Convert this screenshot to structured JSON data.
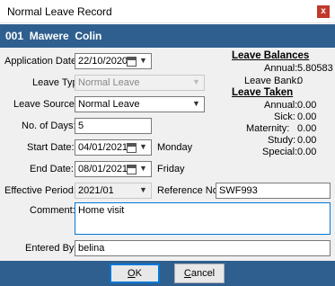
{
  "window": {
    "title": "Normal Leave Record",
    "close_glyph": "x"
  },
  "header": {
    "text": "001  Mawere  Colin"
  },
  "form": {
    "application_date": {
      "label": "Application Date:",
      "value": "22/10/2020"
    },
    "leave_type": {
      "label": "Leave Type:",
      "value": "Normal Leave"
    },
    "leave_source": {
      "label": "Leave Source:",
      "value": "Normal Leave"
    },
    "no_of_days": {
      "label": "No. of Days:",
      "value": "5"
    },
    "start_date": {
      "label": "Start Date:",
      "value": "04/01/2021",
      "weekday": "Monday"
    },
    "end_date": {
      "label": "End Date:",
      "value": "08/01/2021",
      "weekday": "Friday"
    },
    "effective_period": {
      "label": "Effective Period:",
      "value": "2021/01"
    },
    "reference_no": {
      "label": "Reference No.",
      "value": "SWF993"
    },
    "comment": {
      "label": "Comment:",
      "value": "Home visit"
    },
    "entered_by": {
      "label": "Entered By:",
      "value": "belina"
    }
  },
  "leave_balances": {
    "title": "Leave Balances",
    "rows": [
      {
        "label": "Annual:",
        "value": "5.80583"
      },
      {
        "label": "Leave Bank:",
        "value": "0"
      }
    ]
  },
  "leave_taken": {
    "title": "Leave Taken",
    "rows": [
      {
        "label": "Annual:",
        "value": "0.00"
      },
      {
        "label": "Sick:",
        "value": "0.00"
      },
      {
        "label": "Maternity:",
        "value": "0.00"
      },
      {
        "label": "Study:",
        "value": "0.00"
      },
      {
        "label": "Special:",
        "value": "0.00"
      }
    ]
  },
  "buttons": {
    "ok": {
      "mnemonic": "O",
      "rest": "K"
    },
    "cancel": {
      "mnemonic": "C",
      "rest": "ancel"
    }
  },
  "icons": {
    "calendar": "calendar-icon",
    "dropdown": "chevron-down-icon",
    "close": "close-icon"
  },
  "colors": {
    "header_bg": "#2f5f8e",
    "panel_bg": "#f0f0f0",
    "close_bg": "#c0392b",
    "focus_border": "#0078d7"
  }
}
